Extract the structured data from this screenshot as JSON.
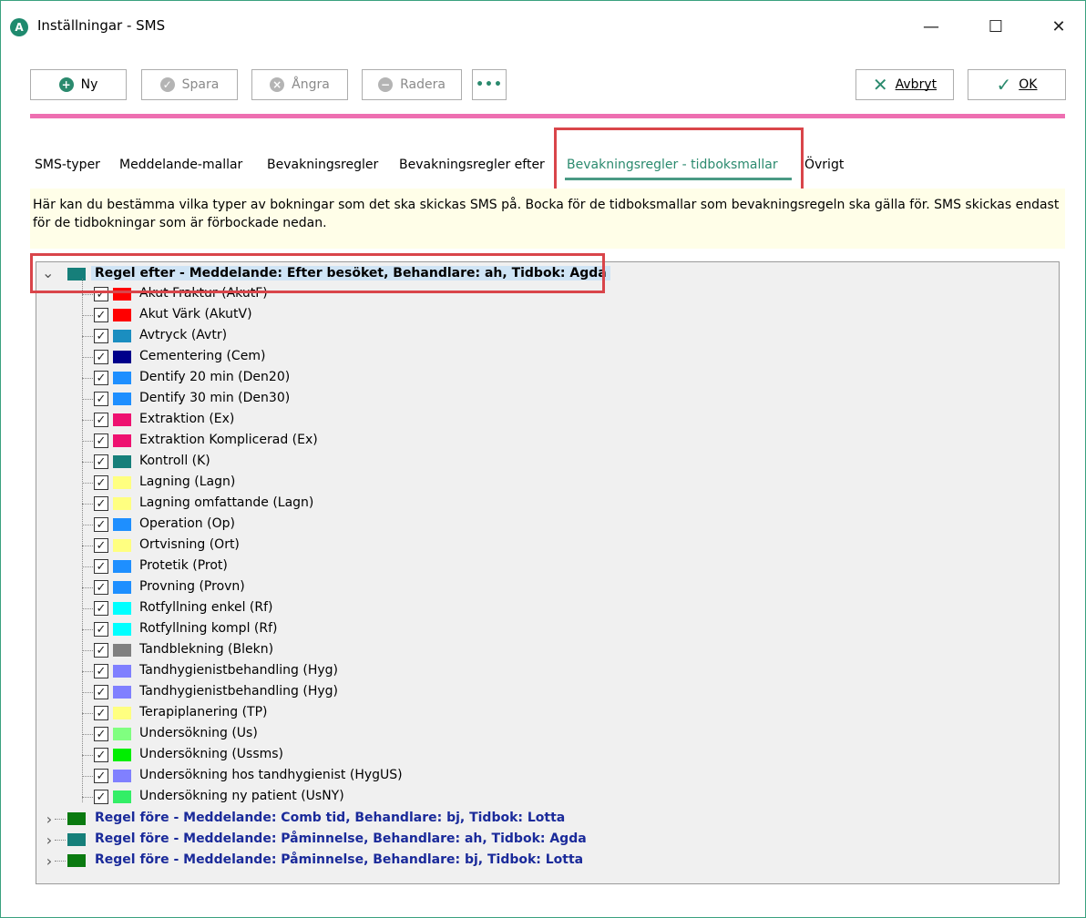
{
  "window": {
    "title": "Inställningar - SMS",
    "app_icon": "A"
  },
  "titlebar_controls": {
    "minimize": "—",
    "maximize": "☐",
    "close": "✕"
  },
  "toolbar": {
    "new_label": "Ny",
    "save_label": "Spara",
    "undo_label": "Ångra",
    "delete_label": "Radera",
    "more_label": "•••",
    "cancel_label": "Avbryt",
    "ok_label": "OK"
  },
  "tabs": [
    {
      "label": "SMS-typer"
    },
    {
      "label": "Meddelande-mallar"
    },
    {
      "label": "Bevakningsregler"
    },
    {
      "label": "Bevakningsregler efter"
    },
    {
      "label": "Bevakningsregler - tidboksmallar"
    },
    {
      "label": "Övrigt"
    }
  ],
  "active_tab": "Bevakningsregler - tidboksmallar",
  "info_text": "Här kan du bestämma vilka typer av bokningar som det ska skickas SMS på. Bocka för de tidboksmallar som bevakningsregeln ska gälla för. SMS skickas endast för de tidbokningar som är förbockade nedan.",
  "tree": {
    "expanded_rule": {
      "label": "Regel efter - Meddelande: Efter besöket, Behandlare: ah, Tidbok: Agda",
      "color": "#167f7a",
      "children": [
        {
          "label": "Akut Fraktur (AkutF)",
          "color": "#ff0000",
          "checked": true
        },
        {
          "label": "Akut Värk (AkutV)",
          "color": "#ff0000",
          "checked": true
        },
        {
          "label": "Avtryck (Avtr)",
          "color": "#1b8ec0",
          "checked": true
        },
        {
          "label": "Cementering (Cem)",
          "color": "#00008b",
          "checked": true
        },
        {
          "label": "Dentify 20 min (Den20)",
          "color": "#1e8fff",
          "checked": true
        },
        {
          "label": "Dentify 30 min (Den30)",
          "color": "#1e8fff",
          "checked": true
        },
        {
          "label": "Extraktion (Ex)",
          "color": "#ee1170",
          "checked": true
        },
        {
          "label": "Extraktion Komplicerad (Ex)",
          "color": "#ee1170",
          "checked": true
        },
        {
          "label": "Kontroll (K)",
          "color": "#167f7a",
          "checked": true
        },
        {
          "label": "Lagning (Lagn)",
          "color": "#ffff80",
          "checked": true
        },
        {
          "label": "Lagning omfattande (Lagn)",
          "color": "#ffff80",
          "checked": true
        },
        {
          "label": "Operation (Op)",
          "color": "#1e8fff",
          "checked": true
        },
        {
          "label": "Ortvisning (Ort)",
          "color": "#ffff80",
          "checked": true
        },
        {
          "label": "Protetik (Prot)",
          "color": "#1e8fff",
          "checked": true
        },
        {
          "label": "Provning (Provn)",
          "color": "#1e8fff",
          "checked": true
        },
        {
          "label": "Rotfyllning enkel (Rf)",
          "color": "#00ffff",
          "checked": true
        },
        {
          "label": "Rotfyllning kompl (Rf)",
          "color": "#00ffff",
          "checked": true
        },
        {
          "label": "Tandblekning (Blekn)",
          "color": "#808080",
          "checked": true
        },
        {
          "label": "Tandhygienistbehandling (Hyg)",
          "color": "#8080ff",
          "checked": true
        },
        {
          "label": "Tandhygienistbehandling (Hyg)",
          "color": "#8080ff",
          "checked": true
        },
        {
          "label": "Terapiplanering (TP)",
          "color": "#ffff80",
          "checked": true
        },
        {
          "label": "Undersökning (Us)",
          "color": "#80ff80",
          "checked": true
        },
        {
          "label": "Undersökning (Ussms)",
          "color": "#00ee00",
          "checked": true
        },
        {
          "label": "Undersökning hos tandhygienist (HygUS)",
          "color": "#8080ff",
          "checked": true
        },
        {
          "label": "Undersökning ny patient (UsNY)",
          "color": "#33ee66",
          "checked": true
        }
      ]
    },
    "collapsed_rules": [
      {
        "label": "Regel före - Meddelande: Comb tid, Behandlare: bj, Tidbok: Lotta",
        "color": "#0a7a10"
      },
      {
        "label": "Regel före - Meddelande: Påminnelse, Behandlare: ah, Tidbok: Agda",
        "color": "#167f7a"
      },
      {
        "label": "Regel före - Meddelande: Påminnelse, Behandlare: bj, Tidbok: Lotta",
        "color": "#0a7a10"
      }
    ]
  }
}
